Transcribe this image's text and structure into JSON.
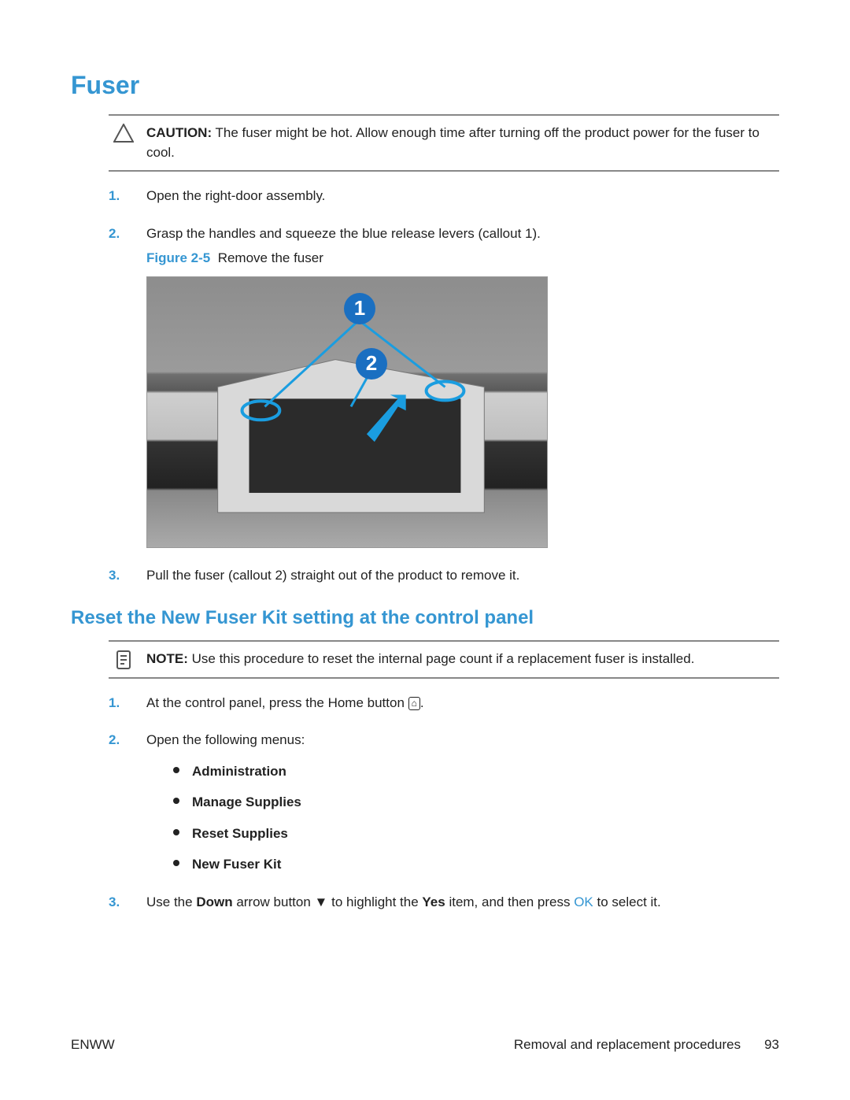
{
  "header": {
    "title": "Fuser"
  },
  "caution": {
    "label": "CAUTION:",
    "text": "The fuser might be hot. Allow enough time after turning off the product power for the fuser to cool."
  },
  "steps1": {
    "s1_num": "1.",
    "s1_text": "Open the right-door assembly.",
    "s2_num": "2.",
    "s2_text": "Grasp the handles and squeeze the blue release levers (callout 1).",
    "fig_label": "Figure 2-5",
    "fig_caption": "Remove the fuser",
    "callout1": "1",
    "callout2": "2",
    "s3_num": "3.",
    "s3_text": "Pull the fuser (callout 2) straight out of the product to remove it."
  },
  "subhead": "Reset the New Fuser Kit setting at the control panel",
  "note": {
    "label": "NOTE:",
    "text": "Use this procedure to reset the internal page count if a replacement fuser is installed."
  },
  "steps2": {
    "s1_num": "1.",
    "s1_text_a": "At the control panel, press the Home button ",
    "s1_text_b": ".",
    "s2_num": "2.",
    "s2_text": "Open the following menus:",
    "menu": {
      "m1": "Administration",
      "m2": "Manage Supplies",
      "m3": "Reset Supplies",
      "m4": "New Fuser Kit"
    },
    "s3_num": "3.",
    "s3_a": "Use the ",
    "s3_down": "Down",
    "s3_b": " arrow button ",
    "s3_c": " to highlight the ",
    "s3_yes": "Yes",
    "s3_d": " item, and then press ",
    "s3_ok": "OK",
    "s3_e": " to select it."
  },
  "footer": {
    "left": "ENWW",
    "section": "Removal and replacement procedures",
    "page": "93"
  }
}
